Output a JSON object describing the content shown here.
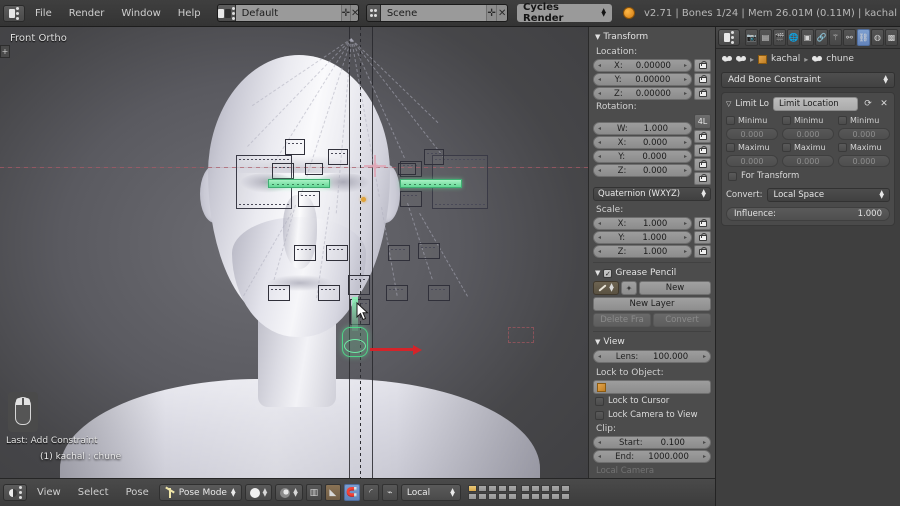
{
  "app": {
    "version_status": "v2.71 | Bones 1/24 | Mem 26.01M (0.11M) | kachal",
    "render_engine": "Cycles Render",
    "screen_layout": "Default",
    "scene": "Scene"
  },
  "top_menu": {
    "items": [
      "File",
      "Render",
      "Window",
      "Help"
    ]
  },
  "viewport": {
    "view_label": "Front Ortho",
    "last_operator": "Last: Add Constraint",
    "object_info": "(1) kachal : chune",
    "plus_toggle": "+"
  },
  "npanel": {
    "transform": {
      "title": "Transform",
      "location_label": "Location:",
      "location": [
        {
          "axis": "X:",
          "value": "0.00000"
        },
        {
          "axis": "Y:",
          "value": "0.00000"
        },
        {
          "axis": "Z:",
          "value": "0.00000"
        }
      ],
      "rotation_label": "Rotation:",
      "rotation": [
        {
          "axis": "W:",
          "value": "1.000"
        },
        {
          "axis": "X:",
          "value": "0.000"
        },
        {
          "axis": "Y:",
          "value": "0.000"
        },
        {
          "axis": "Z:",
          "value": "0.000"
        }
      ],
      "rotation_mode_btn": "4L",
      "rotation_mode": "Quaternion (WXYZ)",
      "scale_label": "Scale:",
      "scale": [
        {
          "axis": "X:",
          "value": "1.000"
        },
        {
          "axis": "Y:",
          "value": "1.000"
        },
        {
          "axis": "Z:",
          "value": "1.000"
        }
      ]
    },
    "grease_pencil": {
      "title": "Grease Pencil",
      "new_btn": "New",
      "new_layer_btn": "New Layer",
      "delete_frame_btn": "Delete Fra",
      "convert_btn": "Convert"
    },
    "view": {
      "title": "View",
      "lens_label": "Lens:",
      "lens_value": "100.000",
      "lock_to_object_label": "Lock to Object:",
      "lock_object_value": "",
      "lock_to_cursor": "Lock to Cursor",
      "lock_camera_to_view": "Lock Camera to View",
      "clip_label": "Clip:",
      "clip_start_label": "Start:",
      "clip_start_value": "0.100",
      "clip_end_label": "End:",
      "clip_end_value": "1000.000",
      "local_camera": "Local Camera"
    }
  },
  "properties": {
    "breadcrumb": {
      "object": "kachal",
      "bone": "chune"
    },
    "add_constraint_label": "Add Bone Constraint",
    "constraint": {
      "type_label": "Limit Lo",
      "name": "Limit Location",
      "columns": [
        {
          "min_label": "Minimu",
          "min_value": "0.000",
          "max_label": "Maximu",
          "max_value": "0.000"
        },
        {
          "min_label": "Minimu",
          "min_value": "0.000",
          "max_label": "Maximu",
          "max_value": "0.000"
        },
        {
          "min_label": "Minimu",
          "min_value": "0.000",
          "max_label": "Maximu",
          "max_value": "0.000"
        }
      ],
      "for_transform_label": "For Transform",
      "convert_label": "Convert:",
      "convert_value": "Local Space",
      "influence_label": "Influence:",
      "influence_value": "1.000"
    }
  },
  "bottombar": {
    "menus": [
      "View",
      "Select",
      "Pose"
    ],
    "mode": "Pose Mode",
    "transform_orientation": "Local"
  },
  "colors": {
    "accent_blue": "#6384bb",
    "selected_bone_green": "#64d795",
    "axis_red": "#d4242a",
    "active_bone_orange": "#e0a33a"
  }
}
